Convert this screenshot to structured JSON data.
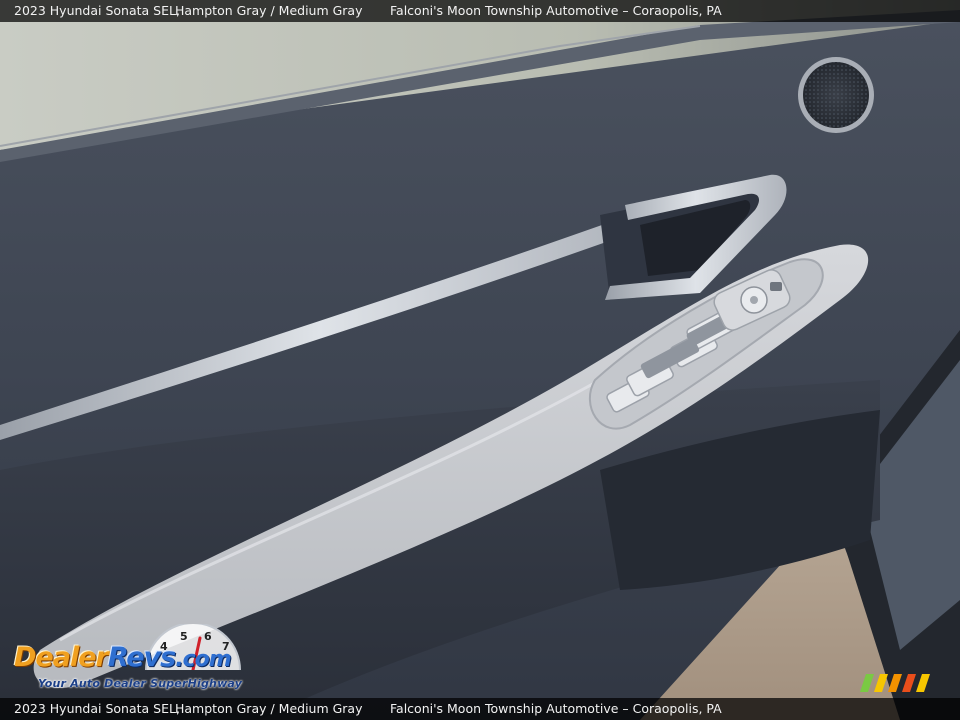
{
  "caption": {
    "vehicle": "2023 Hyundai Sonata SEL,",
    "color": "Hampton Gray / Medium Gray",
    "dealer": "Falconi's Moon Township Automotive – Coraopolis, PA"
  },
  "watermark": {
    "brand_dealer": "Dealer",
    "brand_revs": "Revs",
    "brand_com": ".com",
    "tagline": "Your Auto Dealer SuperHighway",
    "gauge_numbers": [
      "4",
      "5",
      "6",
      "7"
    ],
    "stripe_colors": [
      "#7ac943",
      "#f7c600",
      "#f39200",
      "#e94e1b",
      "#f7c600"
    ]
  },
  "colors": {
    "door_panel": "#3e4552",
    "armrest": "#c9cbd0",
    "chrome": "#c7ccd4",
    "caption_bar": "#000000"
  }
}
